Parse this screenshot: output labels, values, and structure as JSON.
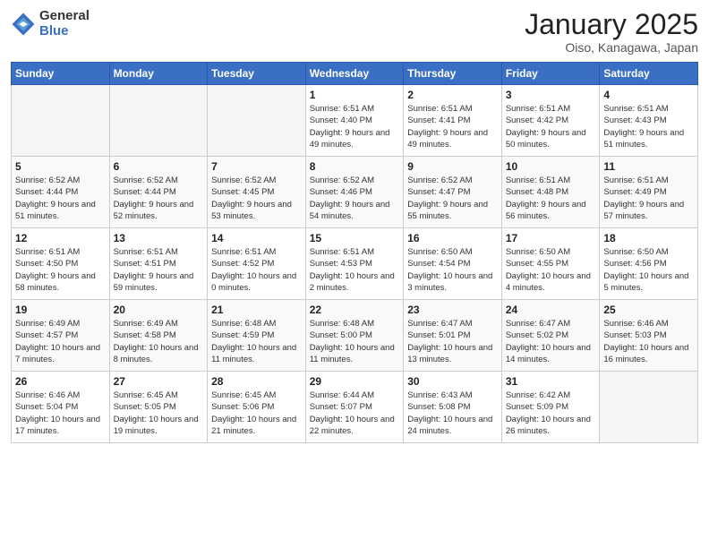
{
  "header": {
    "logo_general": "General",
    "logo_blue": "Blue",
    "month_title": "January 2025",
    "location": "Oiso, Kanagawa, Japan"
  },
  "days_of_week": [
    "Sunday",
    "Monday",
    "Tuesday",
    "Wednesday",
    "Thursday",
    "Friday",
    "Saturday"
  ],
  "weeks": [
    [
      {
        "day": "",
        "info": ""
      },
      {
        "day": "",
        "info": ""
      },
      {
        "day": "",
        "info": ""
      },
      {
        "day": "1",
        "info": "Sunrise: 6:51 AM\nSunset: 4:40 PM\nDaylight: 9 hours and 49 minutes."
      },
      {
        "day": "2",
        "info": "Sunrise: 6:51 AM\nSunset: 4:41 PM\nDaylight: 9 hours and 49 minutes."
      },
      {
        "day": "3",
        "info": "Sunrise: 6:51 AM\nSunset: 4:42 PM\nDaylight: 9 hours and 50 minutes."
      },
      {
        "day": "4",
        "info": "Sunrise: 6:51 AM\nSunset: 4:43 PM\nDaylight: 9 hours and 51 minutes."
      }
    ],
    [
      {
        "day": "5",
        "info": "Sunrise: 6:52 AM\nSunset: 4:44 PM\nDaylight: 9 hours and 51 minutes."
      },
      {
        "day": "6",
        "info": "Sunrise: 6:52 AM\nSunset: 4:44 PM\nDaylight: 9 hours and 52 minutes."
      },
      {
        "day": "7",
        "info": "Sunrise: 6:52 AM\nSunset: 4:45 PM\nDaylight: 9 hours and 53 minutes."
      },
      {
        "day": "8",
        "info": "Sunrise: 6:52 AM\nSunset: 4:46 PM\nDaylight: 9 hours and 54 minutes."
      },
      {
        "day": "9",
        "info": "Sunrise: 6:52 AM\nSunset: 4:47 PM\nDaylight: 9 hours and 55 minutes."
      },
      {
        "day": "10",
        "info": "Sunrise: 6:51 AM\nSunset: 4:48 PM\nDaylight: 9 hours and 56 minutes."
      },
      {
        "day": "11",
        "info": "Sunrise: 6:51 AM\nSunset: 4:49 PM\nDaylight: 9 hours and 57 minutes."
      }
    ],
    [
      {
        "day": "12",
        "info": "Sunrise: 6:51 AM\nSunset: 4:50 PM\nDaylight: 9 hours and 58 minutes."
      },
      {
        "day": "13",
        "info": "Sunrise: 6:51 AM\nSunset: 4:51 PM\nDaylight: 9 hours and 59 minutes."
      },
      {
        "day": "14",
        "info": "Sunrise: 6:51 AM\nSunset: 4:52 PM\nDaylight: 10 hours and 0 minutes."
      },
      {
        "day": "15",
        "info": "Sunrise: 6:51 AM\nSunset: 4:53 PM\nDaylight: 10 hours and 2 minutes."
      },
      {
        "day": "16",
        "info": "Sunrise: 6:50 AM\nSunset: 4:54 PM\nDaylight: 10 hours and 3 minutes."
      },
      {
        "day": "17",
        "info": "Sunrise: 6:50 AM\nSunset: 4:55 PM\nDaylight: 10 hours and 4 minutes."
      },
      {
        "day": "18",
        "info": "Sunrise: 6:50 AM\nSunset: 4:56 PM\nDaylight: 10 hours and 5 minutes."
      }
    ],
    [
      {
        "day": "19",
        "info": "Sunrise: 6:49 AM\nSunset: 4:57 PM\nDaylight: 10 hours and 7 minutes."
      },
      {
        "day": "20",
        "info": "Sunrise: 6:49 AM\nSunset: 4:58 PM\nDaylight: 10 hours and 8 minutes."
      },
      {
        "day": "21",
        "info": "Sunrise: 6:48 AM\nSunset: 4:59 PM\nDaylight: 10 hours and 11 minutes."
      },
      {
        "day": "22",
        "info": "Sunrise: 6:48 AM\nSunset: 5:00 PM\nDaylight: 10 hours and 11 minutes."
      },
      {
        "day": "23",
        "info": "Sunrise: 6:47 AM\nSunset: 5:01 PM\nDaylight: 10 hours and 13 minutes."
      },
      {
        "day": "24",
        "info": "Sunrise: 6:47 AM\nSunset: 5:02 PM\nDaylight: 10 hours and 14 minutes."
      },
      {
        "day": "25",
        "info": "Sunrise: 6:46 AM\nSunset: 5:03 PM\nDaylight: 10 hours and 16 minutes."
      }
    ],
    [
      {
        "day": "26",
        "info": "Sunrise: 6:46 AM\nSunset: 5:04 PM\nDaylight: 10 hours and 17 minutes."
      },
      {
        "day": "27",
        "info": "Sunrise: 6:45 AM\nSunset: 5:05 PM\nDaylight: 10 hours and 19 minutes."
      },
      {
        "day": "28",
        "info": "Sunrise: 6:45 AM\nSunset: 5:06 PM\nDaylight: 10 hours and 21 minutes."
      },
      {
        "day": "29",
        "info": "Sunrise: 6:44 AM\nSunset: 5:07 PM\nDaylight: 10 hours and 22 minutes."
      },
      {
        "day": "30",
        "info": "Sunrise: 6:43 AM\nSunset: 5:08 PM\nDaylight: 10 hours and 24 minutes."
      },
      {
        "day": "31",
        "info": "Sunrise: 6:42 AM\nSunset: 5:09 PM\nDaylight: 10 hours and 26 minutes."
      },
      {
        "day": "",
        "info": ""
      }
    ]
  ]
}
